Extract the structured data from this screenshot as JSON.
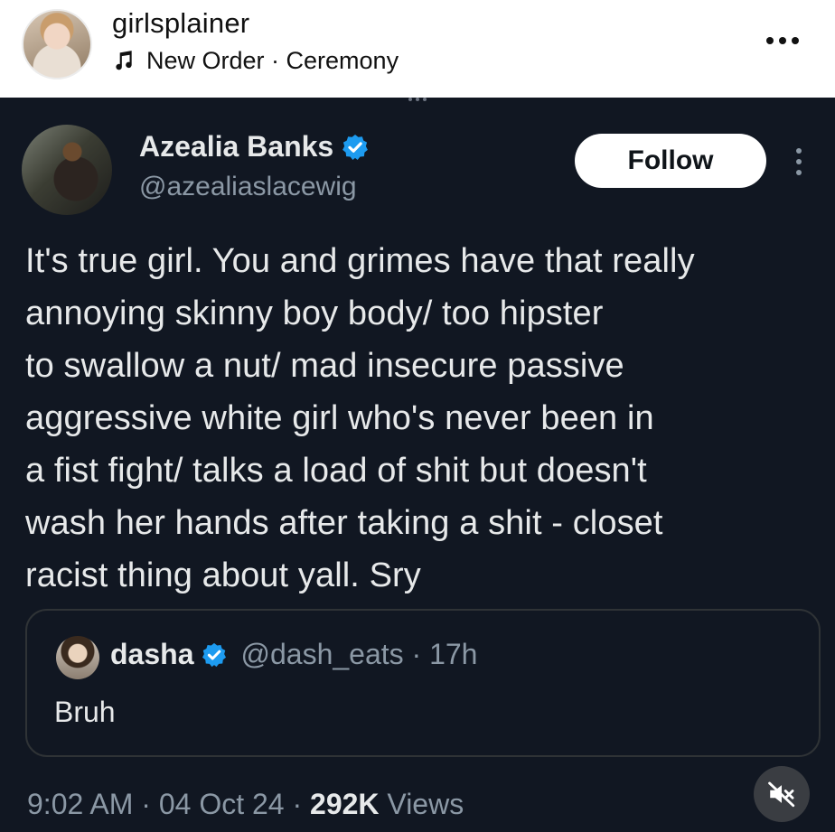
{
  "post_header": {
    "username": "girlsplainer",
    "audio_label": "New Order · Ceremony",
    "avatar_icon": "profile-photo",
    "more_icon": "more-horizontal-icon"
  },
  "tweet": {
    "author_name": "Azealia Banks",
    "author_handle": "@azealiaslacewig",
    "follow_label": "Follow",
    "verified_color": "#1d9bf0",
    "body_lines": [
      "It's true girl. You and grimes have that really",
      "annoying skinny boy body/ too hipster",
      "to swallow a nut/ mad insecure passive",
      "aggressive white girl who's never been in",
      "a fist fight/ talks a load of shit but doesn't",
      "wash her hands after taking a shit - closet",
      "racist thing about yall. Sry"
    ],
    "quote": {
      "name": "dasha",
      "handle_time": "@dash_eats · 17h",
      "text": "Bruh"
    },
    "footer": {
      "time_date": "9:02 AM · 04 Oct 24 · ",
      "views_count": "292K",
      "views_label": " Views"
    },
    "mute_icon": "speaker-muted-icon"
  },
  "colors": {
    "tweet_bg": "#111722",
    "text_primary": "#e7e9ea",
    "text_secondary": "#8b98a5",
    "verified": "#1d9bf0"
  }
}
